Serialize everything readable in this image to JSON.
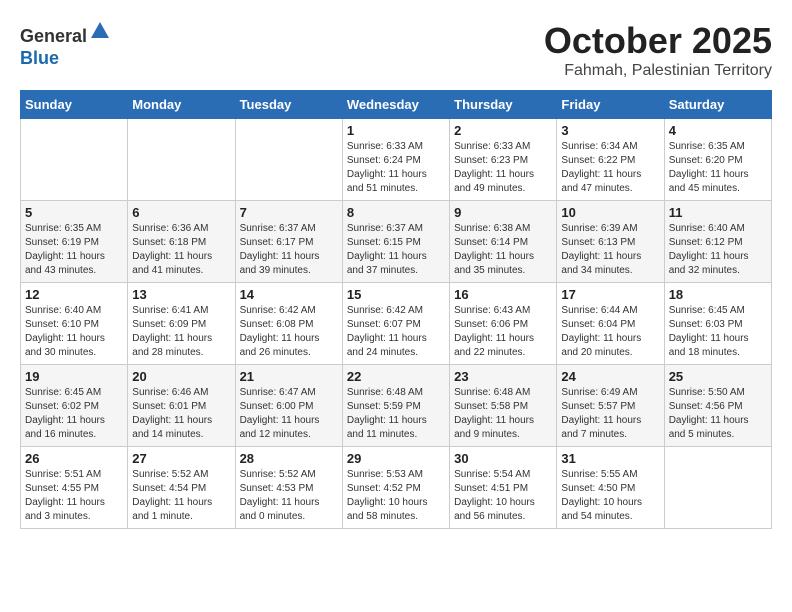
{
  "header": {
    "logo_line1": "General",
    "logo_line2": "Blue",
    "month": "October 2025",
    "location": "Fahmah, Palestinian Territory"
  },
  "days_of_week": [
    "Sunday",
    "Monday",
    "Tuesday",
    "Wednesday",
    "Thursday",
    "Friday",
    "Saturday"
  ],
  "weeks": [
    [
      {
        "day": "",
        "info": ""
      },
      {
        "day": "",
        "info": ""
      },
      {
        "day": "",
        "info": ""
      },
      {
        "day": "1",
        "info": "Sunrise: 6:33 AM\nSunset: 6:24 PM\nDaylight: 11 hours\nand 51 minutes."
      },
      {
        "day": "2",
        "info": "Sunrise: 6:33 AM\nSunset: 6:23 PM\nDaylight: 11 hours\nand 49 minutes."
      },
      {
        "day": "3",
        "info": "Sunrise: 6:34 AM\nSunset: 6:22 PM\nDaylight: 11 hours\nand 47 minutes."
      },
      {
        "day": "4",
        "info": "Sunrise: 6:35 AM\nSunset: 6:20 PM\nDaylight: 11 hours\nand 45 minutes."
      }
    ],
    [
      {
        "day": "5",
        "info": "Sunrise: 6:35 AM\nSunset: 6:19 PM\nDaylight: 11 hours\nand 43 minutes."
      },
      {
        "day": "6",
        "info": "Sunrise: 6:36 AM\nSunset: 6:18 PM\nDaylight: 11 hours\nand 41 minutes."
      },
      {
        "day": "7",
        "info": "Sunrise: 6:37 AM\nSunset: 6:17 PM\nDaylight: 11 hours\nand 39 minutes."
      },
      {
        "day": "8",
        "info": "Sunrise: 6:37 AM\nSunset: 6:15 PM\nDaylight: 11 hours\nand 37 minutes."
      },
      {
        "day": "9",
        "info": "Sunrise: 6:38 AM\nSunset: 6:14 PM\nDaylight: 11 hours\nand 35 minutes."
      },
      {
        "day": "10",
        "info": "Sunrise: 6:39 AM\nSunset: 6:13 PM\nDaylight: 11 hours\nand 34 minutes."
      },
      {
        "day": "11",
        "info": "Sunrise: 6:40 AM\nSunset: 6:12 PM\nDaylight: 11 hours\nand 32 minutes."
      }
    ],
    [
      {
        "day": "12",
        "info": "Sunrise: 6:40 AM\nSunset: 6:10 PM\nDaylight: 11 hours\nand 30 minutes."
      },
      {
        "day": "13",
        "info": "Sunrise: 6:41 AM\nSunset: 6:09 PM\nDaylight: 11 hours\nand 28 minutes."
      },
      {
        "day": "14",
        "info": "Sunrise: 6:42 AM\nSunset: 6:08 PM\nDaylight: 11 hours\nand 26 minutes."
      },
      {
        "day": "15",
        "info": "Sunrise: 6:42 AM\nSunset: 6:07 PM\nDaylight: 11 hours\nand 24 minutes."
      },
      {
        "day": "16",
        "info": "Sunrise: 6:43 AM\nSunset: 6:06 PM\nDaylight: 11 hours\nand 22 minutes."
      },
      {
        "day": "17",
        "info": "Sunrise: 6:44 AM\nSunset: 6:04 PM\nDaylight: 11 hours\nand 20 minutes."
      },
      {
        "day": "18",
        "info": "Sunrise: 6:45 AM\nSunset: 6:03 PM\nDaylight: 11 hours\nand 18 minutes."
      }
    ],
    [
      {
        "day": "19",
        "info": "Sunrise: 6:45 AM\nSunset: 6:02 PM\nDaylight: 11 hours\nand 16 minutes."
      },
      {
        "day": "20",
        "info": "Sunrise: 6:46 AM\nSunset: 6:01 PM\nDaylight: 11 hours\nand 14 minutes."
      },
      {
        "day": "21",
        "info": "Sunrise: 6:47 AM\nSunset: 6:00 PM\nDaylight: 11 hours\nand 12 minutes."
      },
      {
        "day": "22",
        "info": "Sunrise: 6:48 AM\nSunset: 5:59 PM\nDaylight: 11 hours\nand 11 minutes."
      },
      {
        "day": "23",
        "info": "Sunrise: 6:48 AM\nSunset: 5:58 PM\nDaylight: 11 hours\nand 9 minutes."
      },
      {
        "day": "24",
        "info": "Sunrise: 6:49 AM\nSunset: 5:57 PM\nDaylight: 11 hours\nand 7 minutes."
      },
      {
        "day": "25",
        "info": "Sunrise: 5:50 AM\nSunset: 4:56 PM\nDaylight: 11 hours\nand 5 minutes."
      }
    ],
    [
      {
        "day": "26",
        "info": "Sunrise: 5:51 AM\nSunset: 4:55 PM\nDaylight: 11 hours\nand 3 minutes."
      },
      {
        "day": "27",
        "info": "Sunrise: 5:52 AM\nSunset: 4:54 PM\nDaylight: 11 hours\nand 1 minute."
      },
      {
        "day": "28",
        "info": "Sunrise: 5:52 AM\nSunset: 4:53 PM\nDaylight: 11 hours\nand 0 minutes."
      },
      {
        "day": "29",
        "info": "Sunrise: 5:53 AM\nSunset: 4:52 PM\nDaylight: 10 hours\nand 58 minutes."
      },
      {
        "day": "30",
        "info": "Sunrise: 5:54 AM\nSunset: 4:51 PM\nDaylight: 10 hours\nand 56 minutes."
      },
      {
        "day": "31",
        "info": "Sunrise: 5:55 AM\nSunset: 4:50 PM\nDaylight: 10 hours\nand 54 minutes."
      },
      {
        "day": "",
        "info": ""
      }
    ]
  ]
}
